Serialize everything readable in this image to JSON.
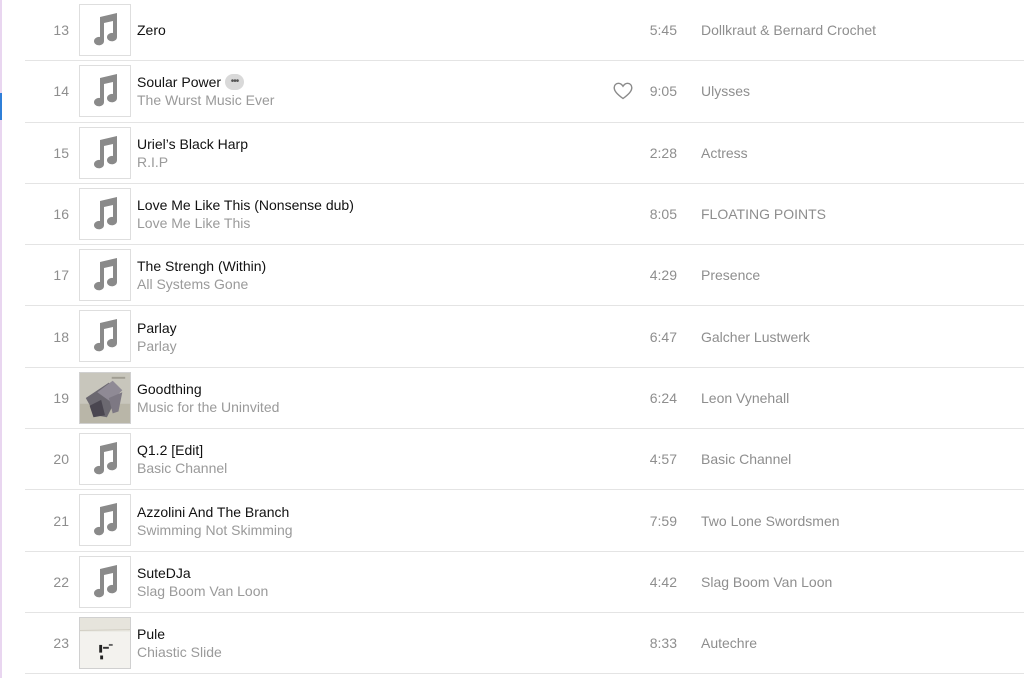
{
  "tracks": [
    {
      "number": "13",
      "title": "Zero",
      "album": "",
      "duration": "5:45",
      "artist": "Dollkraut & Bernard Crochet",
      "artwork": "music-note-icon"
    },
    {
      "number": "14",
      "title": "Soular Power",
      "album": "The Wurst Music Ever",
      "duration": "9:05",
      "artist": "Ulysses",
      "artwork": "music-note-icon",
      "more_label": "•••"
    },
    {
      "number": "15",
      "title": "Uriel’s Black Harp",
      "album": "R.I.P",
      "duration": "2:28",
      "artist": "Actress",
      "artwork": "music-note-icon"
    },
    {
      "number": "16",
      "title": "Love Me Like This (Nonsense dub)",
      "album": "Love Me Like This",
      "duration": "8:05",
      "artist": "FLOATING POINTS",
      "artwork": "music-note-icon"
    },
    {
      "number": "17",
      "title": "The Strengh (Within)",
      "album": "All Systems Gone",
      "duration": "4:29",
      "artist": "Presence",
      "artwork": "music-note-icon"
    },
    {
      "number": "18",
      "title": "Parlay",
      "album": "Parlay",
      "duration": "6:47",
      "artist": "Galcher Lustwerk",
      "artwork": "music-note-icon"
    },
    {
      "number": "19",
      "title": "Goodthing",
      "album": "Music for the Uninvited",
      "duration": "6:24",
      "artist": "Leon Vynehall",
      "artwork": "album-art-image"
    },
    {
      "number": "20",
      "title": "Q1.2 [Edit]",
      "album": "Basic Channel",
      "duration": "4:57",
      "artist": "Basic Channel",
      "artwork": "music-note-icon"
    },
    {
      "number": "21",
      "title": "Azzolini And The Branch",
      "album": "Swimming Not Skimming",
      "duration": "7:59",
      "artist": "Two Lone Swordsmen",
      "artwork": "music-note-icon"
    },
    {
      "number": "22",
      "title": "SuteDJa",
      "album": "Slag Boom Van Loon",
      "duration": "4:42",
      "artist": "Slag Boom Van Loon",
      "artwork": "music-note-icon"
    },
    {
      "number": "23",
      "title": "Pule",
      "album": "Chiastic Slide",
      "duration": "8:33",
      "artist": "Autechre",
      "artwork": "album-art-image"
    }
  ],
  "colors": {
    "title": "#111111",
    "secondary": "#8e8e8e",
    "divider": "#e4e4e4",
    "selection_marker": "#2f7fd8"
  }
}
